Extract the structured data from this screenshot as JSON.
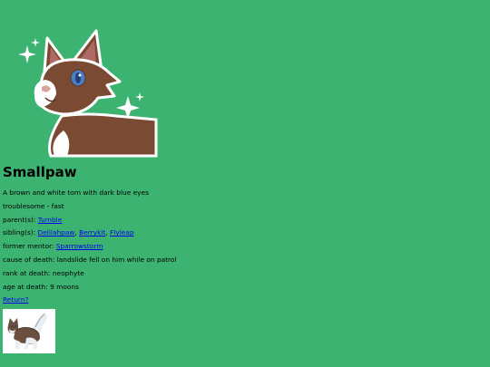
{
  "cat": {
    "name": "Smallpaw",
    "description": "A brown and white tom with dark blue eyes",
    "traits": "troublesome - fast",
    "parents_label": "parent(s):",
    "parents": [
      "Tumble"
    ],
    "siblings_label": "sibling(s):",
    "siblings": [
      "Delilahpaw",
      "Berrykit",
      "Flyleap"
    ],
    "mentor_label": "former mentor:",
    "mentor": "Sparrowstorm",
    "cause_of_death_label": "cause of death:",
    "cause_of_death": "landslide fell on him while on patrol",
    "rank_label": "rank at death:",
    "rank": "neophyte",
    "age_label": "age at death:",
    "age": "9 moons"
  },
  "nav": {
    "return_label": "Return?"
  },
  "colors": {
    "background": "#3cb371",
    "fur_brown": "#7b4a33",
    "link": "#0000ee"
  },
  "images": {
    "portrait": "cat-portrait-icon",
    "sprite": "cat-sprite-icon"
  }
}
